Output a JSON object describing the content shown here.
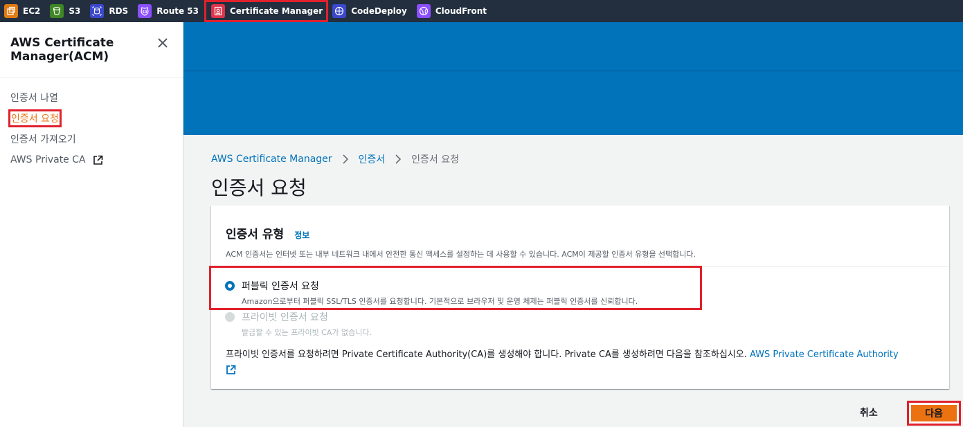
{
  "topbar": {
    "services": [
      {
        "label": "EC2",
        "icon": "ec2-icon",
        "color": "#e07b14"
      },
      {
        "label": "S3",
        "icon": "s3-icon",
        "color": "#3f8624"
      },
      {
        "label": "RDS",
        "icon": "rds-icon",
        "color": "#3b48cc"
      },
      {
        "label": "Route 53",
        "icon": "route53-icon",
        "color": "#8c4fff"
      },
      {
        "label": "Certificate Manager",
        "icon": "certificate-manager-icon",
        "color": "#dd344c"
      },
      {
        "label": "CodeDeploy",
        "icon": "codedeploy-icon",
        "color": "#3b48cc"
      },
      {
        "label": "CloudFront",
        "icon": "cloudfront-icon",
        "color": "#8c4fff"
      }
    ]
  },
  "sidebar": {
    "title": "AWS Certificate Manager(ACM)",
    "items": [
      {
        "label": "인증서 나열"
      },
      {
        "label": "인증서 요청"
      },
      {
        "label": "인증서 가져오기"
      },
      {
        "label": "AWS Private CA"
      }
    ]
  },
  "breadcrumb": {
    "items": [
      "AWS Certificate Manager",
      "인증서",
      "인증서 요청"
    ]
  },
  "page": {
    "title": "인증서 요청"
  },
  "panel": {
    "title": "인증서 유형",
    "info": "정보",
    "description": "ACM 인증서는 인터넷 또는 내부 네트워크 내에서 안전한 통신 액세스를 설정하는 데 사용할 수 있습니다. ACM이 제공할 인증서 유형을 선택합니다.",
    "options": [
      {
        "label": "퍼블릭 인증서 요청",
        "description": "Amazon으로부터 퍼블릭 SSL/TLS 인증서를 요청합니다. 기본적으로 브라우저 및 운영 체제는 퍼블릭 인증서를 신뢰합니다.",
        "selected": true,
        "disabled": false
      },
      {
        "label": "프라이빗 인증서 요청",
        "description": "발급할 수 있는 프라이빗 CA가 없습니다.",
        "selected": false,
        "disabled": true
      }
    ],
    "note": "프라이빗 인증서를 요청하려면 Private Certificate Authority(CA)를 생성해야 합니다. Private CA를 생성하려면 다음을 참조하십시오.",
    "note_link": "AWS Private Certificate Authority"
  },
  "actions": {
    "cancel": "취소",
    "next": "다음"
  },
  "colors": {
    "accent": "#0073bb",
    "primary_button": "#ec7211",
    "highlight_box": "#e0212c"
  }
}
